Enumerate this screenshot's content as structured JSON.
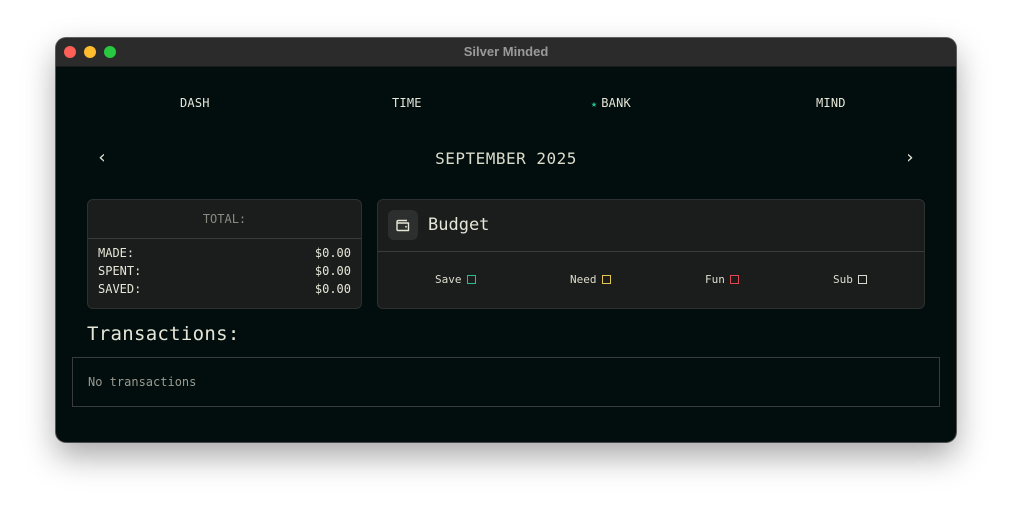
{
  "window": {
    "title": "Silver Minded"
  },
  "nav": {
    "items": [
      {
        "label": "DASH"
      },
      {
        "label": "TIME"
      },
      {
        "label": "BANK",
        "active_marker": "★"
      },
      {
        "label": "MIND"
      }
    ],
    "active": "BANK"
  },
  "month": {
    "label": "SEPTEMBER 2025",
    "prev_icon": "‹",
    "next_icon": "›"
  },
  "totals": {
    "header": "TOTAL:",
    "rows": [
      {
        "label": "MADE:",
        "value": "$0.00"
      },
      {
        "label": "SPENT:",
        "value": "$0.00"
      },
      {
        "label": "SAVED:",
        "value": "$0.00"
      }
    ]
  },
  "budget": {
    "title": "Budget",
    "icon": "wallet-icon",
    "legend": [
      {
        "label": "Save",
        "color": "#23c28d"
      },
      {
        "label": "Need",
        "color": "#e4c650"
      },
      {
        "label": "Fun",
        "color": "#e2464f"
      },
      {
        "label": "Sub",
        "color": "#d8d8d0"
      }
    ]
  },
  "transactions": {
    "title": "Transactions:",
    "empty_text": "No transactions"
  },
  "colors": {
    "background": "#010e0d",
    "card": "#1b1c1c",
    "accent": "#23c28d",
    "text": "#e6e6d8"
  }
}
